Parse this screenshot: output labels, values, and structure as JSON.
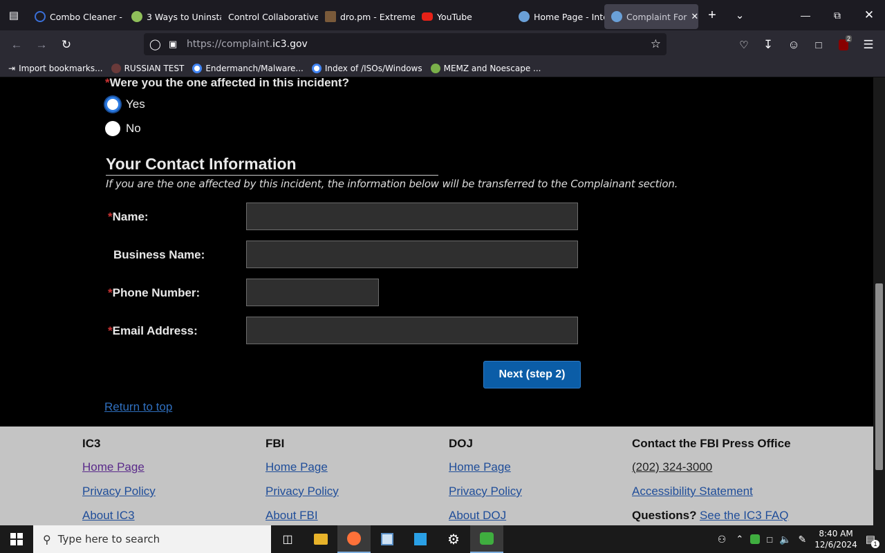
{
  "browser": {
    "tabs": [
      {
        "label": "Combo Cleaner -",
        "color": "#3a6fd8"
      },
      {
        "label": "3 Ways to Uninsta",
        "color": "#8fbf5a"
      },
      {
        "label": "Control Collaborative",
        "color": ""
      },
      {
        "label": "dro.pm - Extreme",
        "color": "#7a5a3a"
      },
      {
        "label": "YouTube",
        "color": "#e62117"
      },
      {
        "label": "Home Page - Inte",
        "color": "#6aa0d8"
      },
      {
        "label": "Complaint For",
        "color": "#6aa0d8"
      }
    ],
    "url_prefix": "https://complaint.",
    "url_domain": "ic3.gov",
    "bookmarks": [
      {
        "label": "Import bookmarks..."
      },
      {
        "label": "RUSSIAN TEST"
      },
      {
        "label": "Endermanch/Malware..."
      },
      {
        "label": "Index of /ISOs/Windows"
      },
      {
        "label": "MEMZ and Noescape ..."
      }
    ],
    "extensions_badge": "2"
  },
  "form": {
    "question": "Were you the one affected in this incident?",
    "req_mark": "*",
    "yes_label": "Yes",
    "no_label": "No",
    "section_title": "Your Contact Information",
    "section_subtitle": "If you are the one affected by this incident, the information below will be transferred to the Complainant section.",
    "name_label": "Name:",
    "business_label": "Business Name:",
    "phone_label": "Phone Number:",
    "email_label": "Email Address:",
    "name_value": "",
    "business_value": "",
    "phone_value": "",
    "email_value": "",
    "next_label": "Next (step 2)",
    "return_label": "Return to top"
  },
  "footer": {
    "ic3": {
      "heading": "IC3",
      "links": [
        "Home Page",
        "Privacy Policy",
        "About IC3"
      ]
    },
    "fbi": {
      "heading": "FBI",
      "links": [
        "Home Page",
        "Privacy Policy",
        "About FBI"
      ]
    },
    "doj": {
      "heading": "DOJ",
      "links": [
        "Home Page",
        "Privacy Policy",
        "About DOJ"
      ]
    },
    "contact": {
      "heading": "Contact the FBI Press Office",
      "phone": "(202) 324-3000",
      "accessibility": "Accessibility Statement",
      "questions": "Questions?",
      "faq": "See the IC3 FAQ"
    }
  },
  "taskbar": {
    "search_placeholder": "Type here to search",
    "time": "8:40 AM",
    "date": "12/6/2024",
    "notif_count": "1"
  }
}
